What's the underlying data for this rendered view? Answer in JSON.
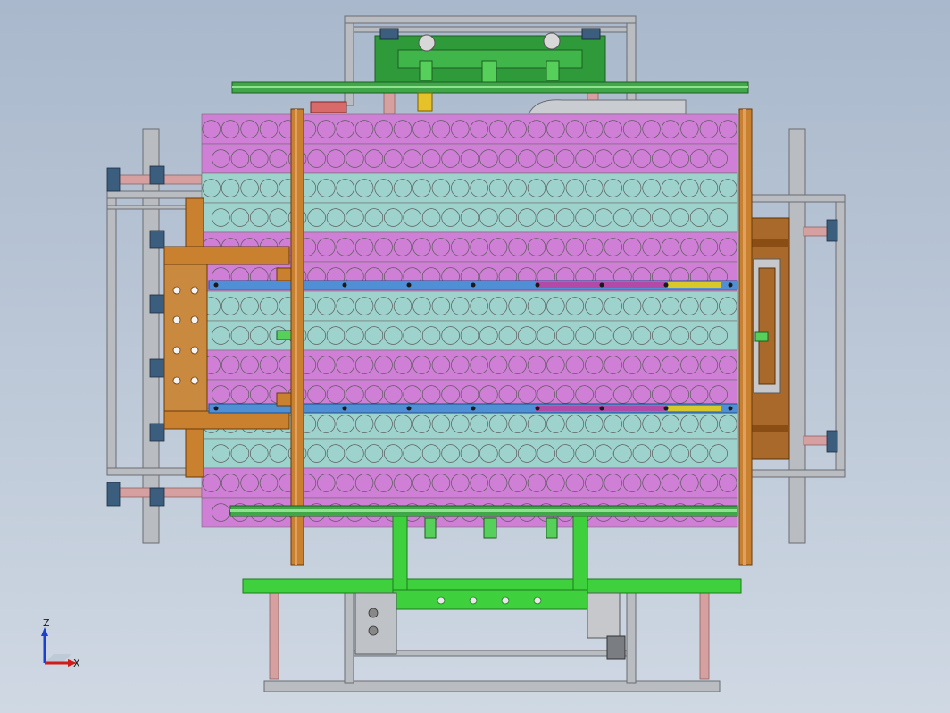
{
  "viewport": {
    "background_top": "#a9b8cc",
    "background_bottom": "#cfd8e3"
  },
  "colors": {
    "magenta_row": "#cf7fd6",
    "cyan_row": "#9ed3cd",
    "frame_grey": "#b9bcc0",
    "frame_edge": "#6a6d72",
    "wood_orange": "#c9802f",
    "wood_dark": "#8a4e14",
    "green_frame": "#3fd13d",
    "green_dark": "#2a7f2a",
    "blue_rail": "#4f8fd6",
    "pink_rod": "#d6a0a0"
  },
  "model": {
    "row_pattern": [
      "magenta",
      "magenta",
      "cyan",
      "cyan",
      "magenta",
      "magenta",
      "cyan",
      "cyan",
      "magenta",
      "magenta",
      "cyan",
      "cyan",
      "magenta",
      "magenta"
    ],
    "circles_per_row": 28
  },
  "triad": {
    "z_label": "Z",
    "x_label": "X",
    "z_color": "#1b3fcf",
    "x_color": "#d01b1b",
    "y_color": "#1e9a2a"
  }
}
